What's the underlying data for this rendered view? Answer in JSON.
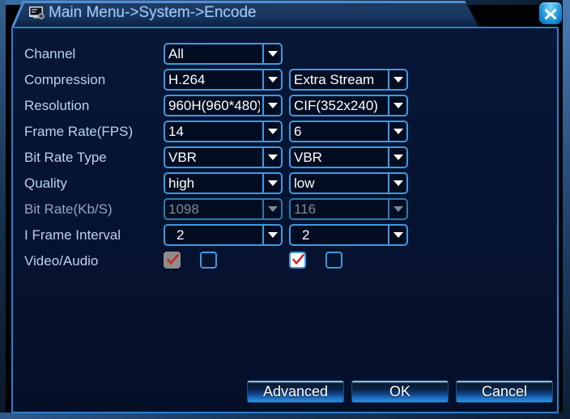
{
  "window": {
    "title": "Main Menu->System->Encode",
    "title_icon": "monitor-settings-icon",
    "close_icon": "close-icon"
  },
  "form": {
    "rows": [
      {
        "label": "Channel",
        "main": {
          "value": "All",
          "enabled": true
        },
        "sub": null
      },
      {
        "label": "Compression",
        "main": {
          "value": "H.264",
          "enabled": true
        },
        "sub": {
          "value": "Extra Stream",
          "enabled": true
        }
      },
      {
        "label": "Resolution",
        "main": {
          "value": "960H(960*480)",
          "enabled": true
        },
        "sub": {
          "value": "CIF(352x240)",
          "enabled": true
        }
      },
      {
        "label": "Frame Rate(FPS)",
        "main": {
          "value": "14",
          "enabled": true
        },
        "sub": {
          "value": "6",
          "enabled": true
        }
      },
      {
        "label": "Bit Rate Type",
        "main": {
          "value": "VBR",
          "enabled": true
        },
        "sub": {
          "value": "VBR",
          "enabled": true
        }
      },
      {
        "label": "Quality",
        "main": {
          "value": "high",
          "enabled": true
        },
        "sub": {
          "value": "low",
          "enabled": true
        }
      },
      {
        "label": "Bit Rate(Kb/S)",
        "main": {
          "value": "1098",
          "enabled": false
        },
        "sub": {
          "value": "116",
          "enabled": false
        }
      },
      {
        "label": "I Frame Interval",
        "main": {
          "value": "2",
          "enabled": true
        },
        "sub": {
          "value": "2",
          "enabled": true
        }
      }
    ],
    "video_audio": {
      "label": "Video/Audio",
      "main_video_checked": true,
      "main_video_enabled": false,
      "main_audio_checked": false,
      "sub_video_checked": true,
      "sub_video_enabled": true,
      "sub_audio_checked": false
    }
  },
  "buttons": {
    "advanced": "Advanced",
    "ok": "OK",
    "cancel": "Cancel"
  },
  "colors": {
    "accent": "#3e9ae2",
    "dialog_bg": "#06142e",
    "label_text": "#b9d2ef",
    "value_text": "#ffffff",
    "disabled_text": "#7d8896",
    "check_red": "#d81f1f"
  }
}
